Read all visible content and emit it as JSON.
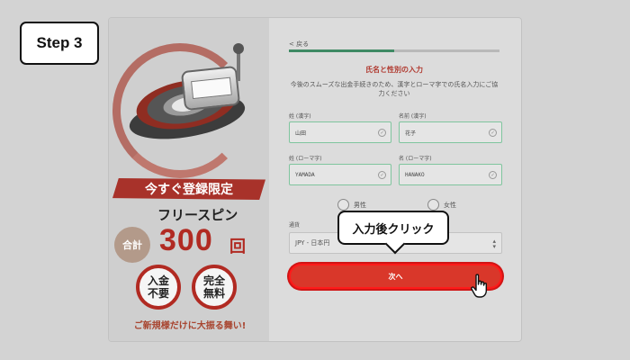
{
  "step": {
    "label": "Step 3"
  },
  "promo": {
    "banner": "今すぐ登録限定",
    "free_spins": "フリースピン",
    "total_label": "合計",
    "amount": "300",
    "unit": "回",
    "badge1": "入金\n不要",
    "badge2": "完全\n無料",
    "catchphrase": "ご新規様だけに大振る舞い!"
  },
  "form": {
    "back": "< 戻る",
    "progress": 0.5,
    "title": "氏名と性別の入力",
    "description": "今後のスムーズな出金手続きのため、漢字とローマ字での氏名入力にご協力ください",
    "fields": {
      "last_name_kanji": {
        "label": "姓 (漢字)",
        "value": "山田"
      },
      "first_name_kanji": {
        "label": "名前 (漢字)",
        "value": "花子"
      },
      "last_name_roman": {
        "label": "姓 (ローマ字)",
        "value": "YAMADA"
      },
      "first_name_roman": {
        "label": "名 (ローマ字)",
        "value": "HANAKO"
      }
    },
    "gender": {
      "male": "男性",
      "female": "女性"
    },
    "currency": {
      "label": "通貨",
      "value": "JPY - 日本円"
    },
    "next_button": "次へ"
  },
  "annotation": {
    "callout": "入力後クリック"
  },
  "colors": {
    "accent": "#d9372a",
    "highlight": "#ff1a1a",
    "field_border": "#7fc59e",
    "progress": "#3f8a64"
  },
  "icons": [
    "check-circle-icon",
    "chevron-updown-icon",
    "hand-pointer-icon"
  ]
}
